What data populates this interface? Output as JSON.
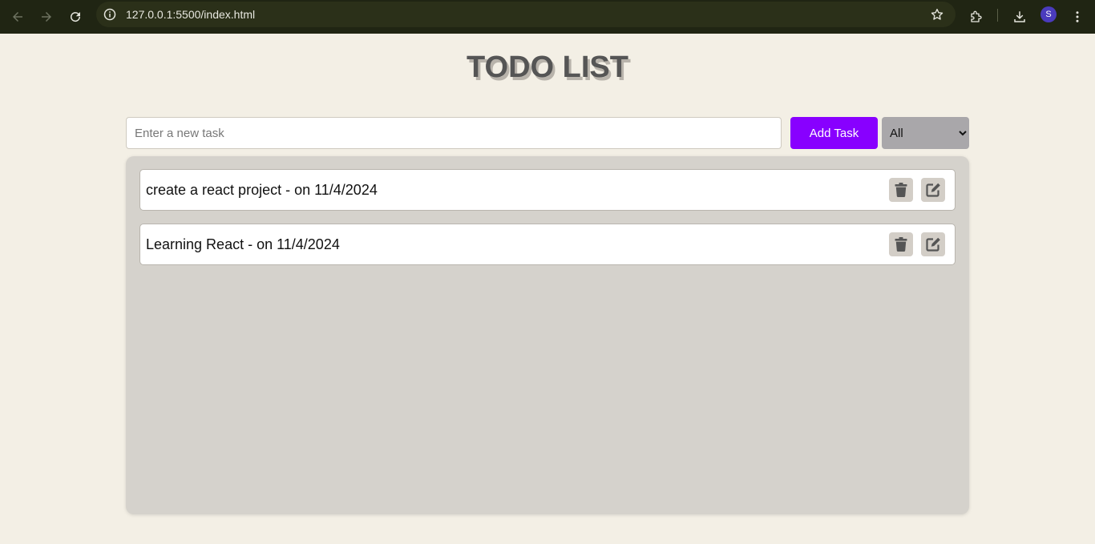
{
  "browser": {
    "url": "127.0.0.1:5500/index.html",
    "profile_initial": "S",
    "icons": [
      "back-arrow-icon",
      "forward-arrow-icon",
      "reload-icon",
      "info-icon",
      "star-icon",
      "extensions-icon",
      "download-icon",
      "menu-icon"
    ]
  },
  "app": {
    "title": "TODO LIST",
    "input": {
      "placeholder": "Enter a new task",
      "value": ""
    },
    "add_button_label": "Add Task",
    "filter": {
      "selected": "All"
    },
    "tasks": [
      {
        "text": "create a react project - on 11/4/2024"
      },
      {
        "text": "Learning React - on 11/4/2024"
      }
    ]
  },
  "colors": {
    "page_background": "#f3efe5",
    "accent": "#8800ff",
    "panel": "#d5d2cc",
    "icon_button": "#d3cec7",
    "icon": "#555555",
    "chrome": "#202513"
  }
}
